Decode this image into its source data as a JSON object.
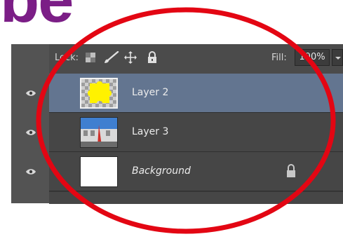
{
  "slide": {
    "title_fragment": "be",
    "title_color": "#7b1e86"
  },
  "panel": {
    "lock_label": "Lock:",
    "fill_label": "Fill:",
    "fill_value": "100%",
    "lock_icons": [
      "transparency-lock-icon",
      "brush-lock-icon",
      "move-lock-icon",
      "padlock-icon"
    ],
    "layers": [
      {
        "name": "Layer 2",
        "selected": true,
        "thumbnail": "yellow-puzzle-piece-on-checkerboard"
      },
      {
        "name": "Layer 3",
        "selected": false,
        "thumbnail": "building-photo"
      },
      {
        "name": "Background",
        "selected": false,
        "thumbnail": "white",
        "locked": true
      }
    ],
    "selected_color": "#637590"
  },
  "annotation": {
    "circle_color": "#e30613"
  }
}
